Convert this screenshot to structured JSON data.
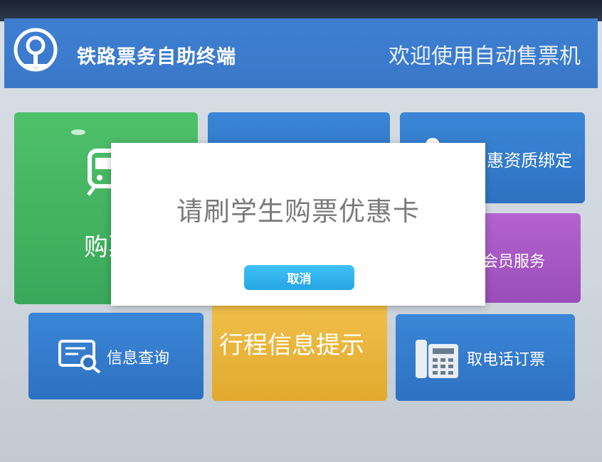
{
  "header": {
    "brand": "铁路票务自助终端",
    "welcome": "欢迎使用自动售票机"
  },
  "tiles": {
    "buy": "购票",
    "preference": "惠资质绑定",
    "member": "会员服务",
    "info_query": "信息查询",
    "trip_info": "行程信息提示",
    "phone_ticket": "取电话订票"
  },
  "modal": {
    "message": "请刷学生购票优惠卡",
    "cancel_label": "取消"
  },
  "colors": {
    "header_blue": "#3e7fd1",
    "tile_green": "#4fc06a",
    "tile_blue": "#2e73c4",
    "tile_purple": "#a957c4",
    "tile_yellow": "#e9b33a",
    "cancel_button": "#2eb3ef"
  },
  "icons": [
    "railway-logo-icon",
    "train-icon",
    "user-icon",
    "search-icon",
    "phone-icon"
  ]
}
